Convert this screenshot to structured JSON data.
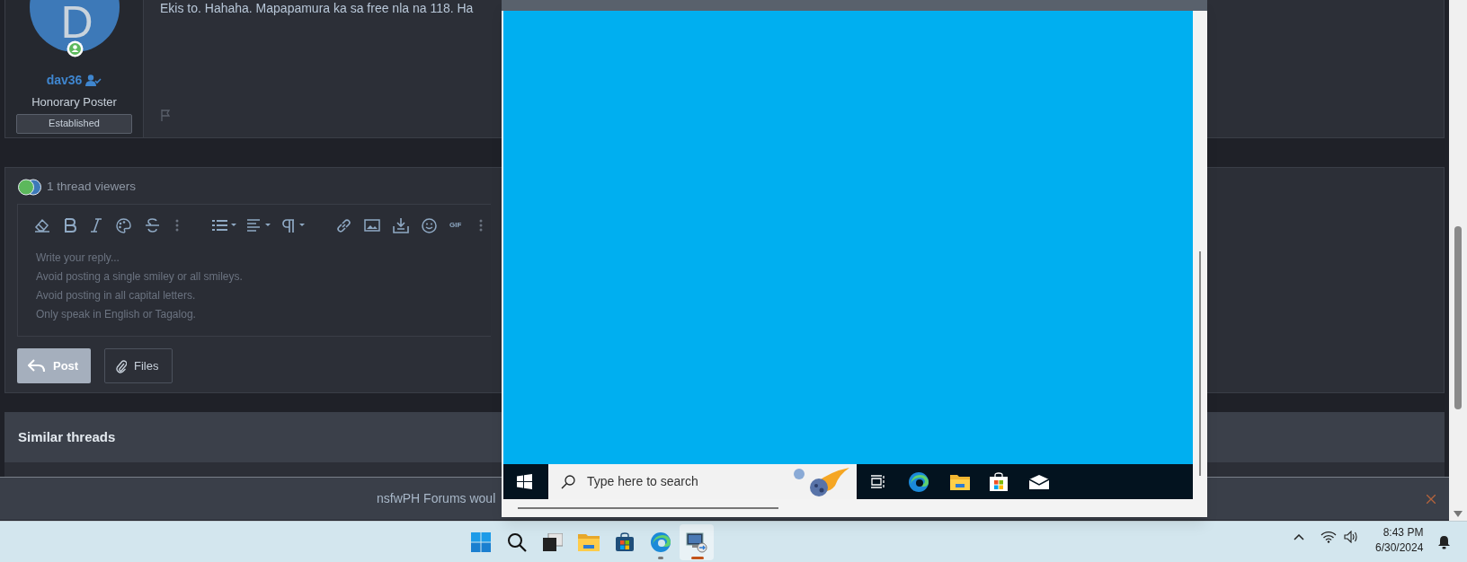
{
  "post": {
    "avatar_letter": "D",
    "username": "dav36",
    "user_title": "Honorary Poster",
    "banner": "Established",
    "message": "Ekis to. Hahaha. Mapapamura ka sa free nla na 118. Ha"
  },
  "thread_viewers": {
    "label": "1 thread viewers"
  },
  "editor": {
    "gif_label": "GIF",
    "placeholder_lines": [
      "Write your reply...",
      "Avoid posting a single smiley or all smileys.",
      "Avoid posting in all capital letters.",
      "Only speak in English or Tagalog."
    ],
    "buttons": [
      {
        "label": "Post",
        "kind": "primary"
      },
      {
        "label": "Files",
        "kind": "secondary"
      }
    ]
  },
  "similar_threads": {
    "title": "Similar threads"
  },
  "cookie_notice": {
    "text": "nsfwPH Forums woul"
  },
  "remote_desktop": {
    "search_placeholder": "Type here to search"
  },
  "taskbar": {
    "apps": [
      {
        "kind": "start",
        "running": false,
        "selected": false
      },
      {
        "kind": "search",
        "running": false,
        "selected": false
      },
      {
        "kind": "task-view",
        "running": false,
        "selected": false
      },
      {
        "kind": "explorer",
        "running": false,
        "selected": false
      },
      {
        "kind": "store",
        "running": false,
        "selected": false
      },
      {
        "kind": "edge",
        "running": true,
        "selected": false
      },
      {
        "kind": "remote-desktop",
        "running": true,
        "selected": true
      }
    ],
    "time": "8:43 PM",
    "date": "6/30/2024"
  }
}
